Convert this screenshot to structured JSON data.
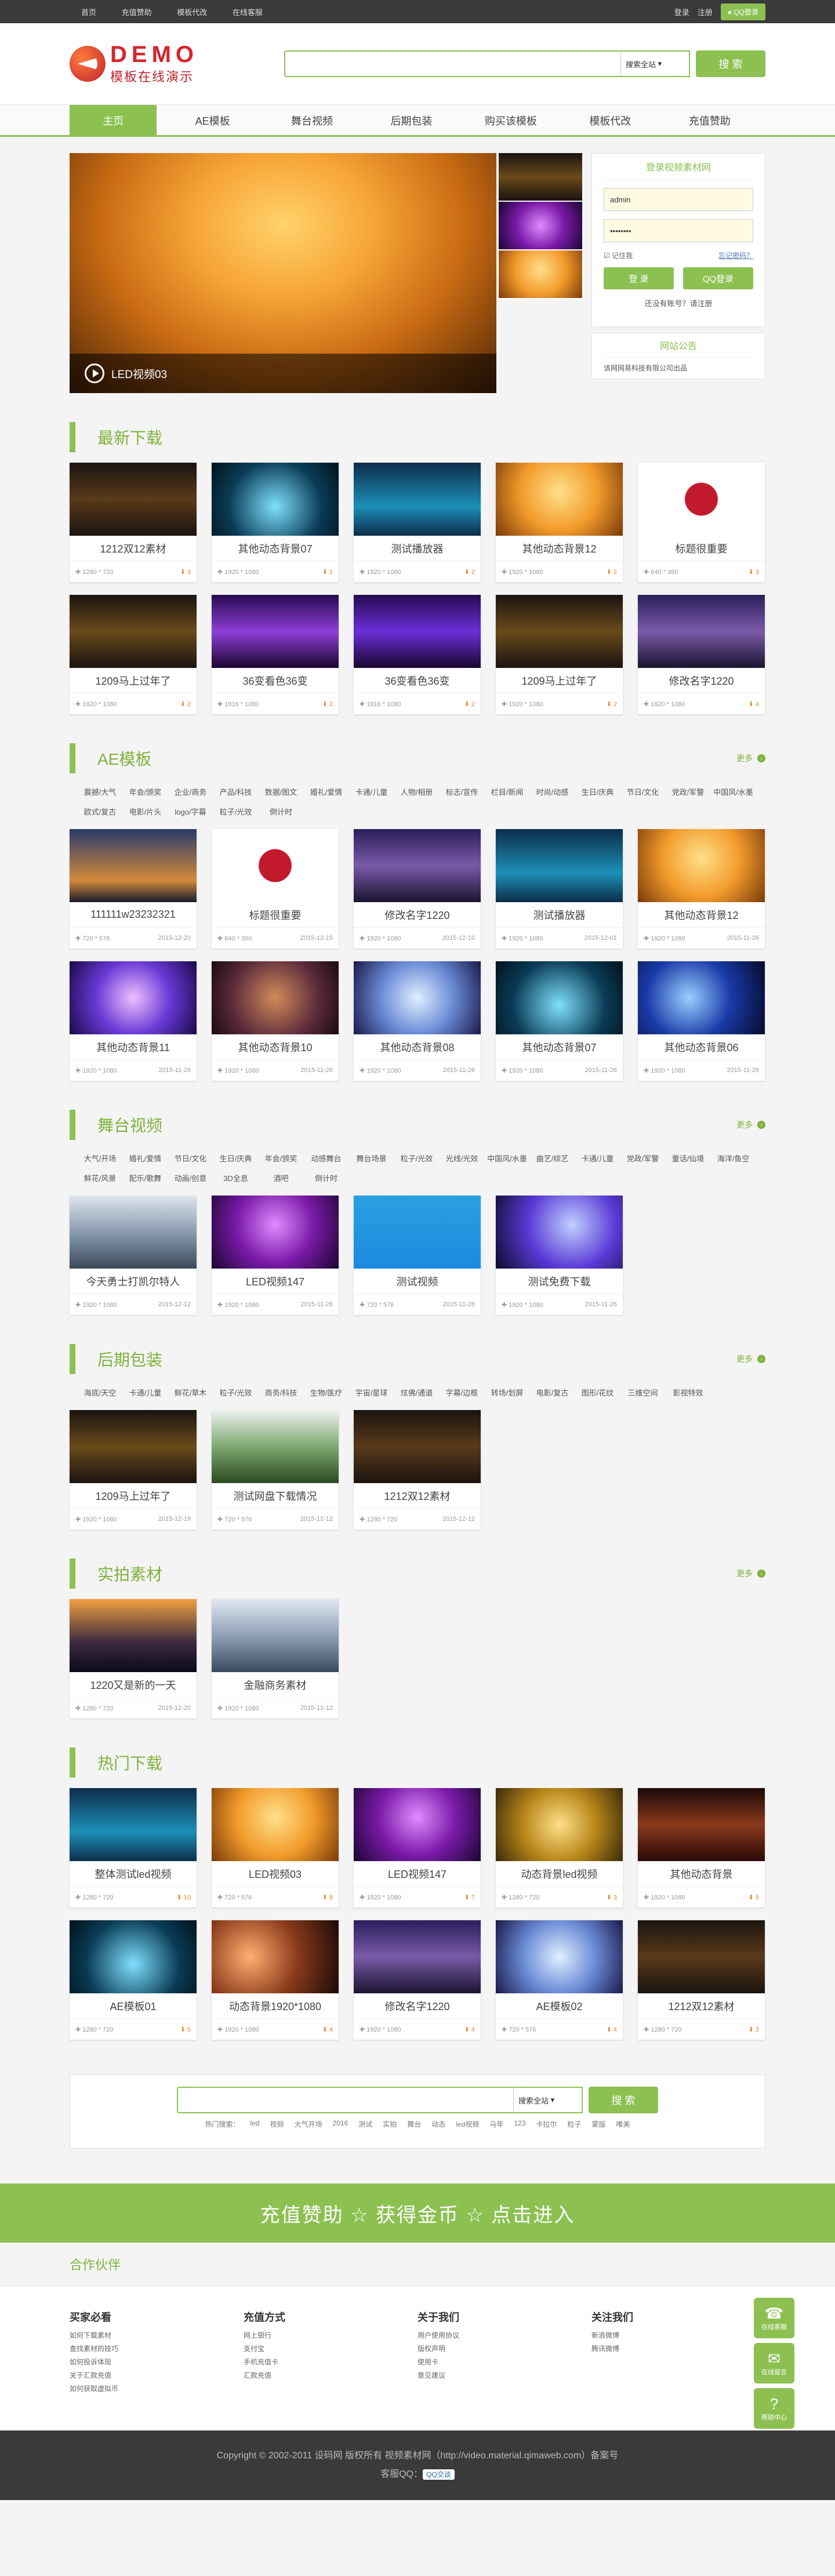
{
  "topbar": {
    "links": [
      "首页",
      "充值赞助",
      "模板代改",
      "在线客服"
    ],
    "login": "登录",
    "register": "注册",
    "qq": "QQ登录"
  },
  "header": {
    "logo_title": "DEMO",
    "logo_sub": "模板在线演示",
    "search_scope": "搜索全站",
    "search_btn": "搜 索"
  },
  "nav": [
    "主页",
    "AE模板",
    "舞台视频",
    "后期包装",
    "购买该模板",
    "模板代改",
    "充值赞助"
  ],
  "banner": {
    "caption": "LED视频03"
  },
  "login": {
    "title": "登录视频素材网",
    "username": "admin",
    "password": "••••••••",
    "remember": "记住我",
    "forgot": "忘记密码？",
    "login_btn": "登 录",
    "qq_btn": "QQ登录",
    "noacc": "还没有账号？请注册"
  },
  "notice": {
    "title": "网站公告",
    "text": "该网网易科技有限公司出品"
  },
  "sections": {
    "latest": {
      "title": "最新下载",
      "items": [
        {
          "name": "1212双12素材",
          "meta": "1280 * 720",
          "count": "3",
          "bg": "linear-gradient(#1a1410,#5a3a1a 50%,#1a1410)"
        },
        {
          "name": "其他动态背景07",
          "meta": "1920 * 1080",
          "count": "1",
          "bg": "radial-gradient(circle at 50% 60%,#7fe0ff,#0a3c55 60%,#02121c)"
        },
        {
          "name": "测试播放器",
          "meta": "1920 * 1080",
          "count": "2",
          "bg": "linear-gradient(#0c2d4a,#1d8fb8 60%,#0c2d4a)"
        },
        {
          "name": "其他动态背景12",
          "meta": "1920 * 1080",
          "count": "2",
          "bg": "radial-gradient(circle at 50% 40%,#ffe08a,#f29b2b 50%,#7a3a08)"
        },
        {
          "name": "标题很重要",
          "meta": "640 * 360",
          "count": "3",
          "bg": "radial-gradient(circle,#c21a2c 0 22%,#fff 23%)"
        },
        {
          "name": "1209马上过年了",
          "meta": "1920 * 1080",
          "count": "2",
          "bg": "linear-gradient(#1a1410,#6a4a1a 50%,#1a1410)"
        },
        {
          "name": "36变看色36变",
          "meta": "1916 * 1080",
          "count": "2",
          "bg": "linear-gradient(#260a52,#8f3ed6 50%,#1a0630)"
        },
        {
          "name": "36变看色36变",
          "meta": "1916 * 1080",
          "count": "2",
          "bg": "linear-gradient(#260a52,#6b2fd6 50%,#1a0630)"
        },
        {
          "name": "1209马上过年了",
          "meta": "1920 * 1080",
          "count": "2",
          "bg": "linear-gradient(#1a1410,#6a4a1a 50%,#1a1410)"
        },
        {
          "name": "修改名字1220",
          "meta": "1920 * 1080",
          "count": "4",
          "bg": "linear-gradient(#2a1e5a,#7a5aa8 50%,#1a1430)"
        }
      ]
    },
    "ae": {
      "title": "AE模板",
      "more": "更多",
      "tags": [
        "震撼/大气",
        "年会/颁奖",
        "企业/商务",
        "产品/科技",
        "数据/图文",
        "婚礼/爱情",
        "卡通/儿童",
        "人物/相册",
        "标志/宣传",
        "栏目/新闻",
        "时尚/动感",
        "生日/庆典",
        "节日/文化",
        "党政/军警",
        "中国风/水墨",
        "欧式/复古",
        "电影/片头",
        "logo/字幕",
        "粒子/光效",
        "倒计时"
      ],
      "items": [
        {
          "name": "111111w23232321",
          "meta": "720 * 576",
          "date": "2015-12-20",
          "bg": "linear-gradient(#2a3a6a,#d28a3a 70%,#1a1a2a)"
        },
        {
          "name": "标题很重要",
          "meta": "640 * 360",
          "date": "2015-12-15",
          "bg": "radial-gradient(circle,#c21a2c 0 22%,#fff 23%)"
        },
        {
          "name": "修改名字1220",
          "meta": "1920 * 1080",
          "date": "2015-12-10",
          "bg": "linear-gradient(#2a1e5a,#7a5aa8 50%,#1a1430)"
        },
        {
          "name": "测试播放器",
          "meta": "1920 * 1080",
          "date": "2015-12-01",
          "bg": "linear-gradient(#0c2d4a,#1d8fb8 60%,#0c2d4a)"
        },
        {
          "name": "其他动态背景12",
          "meta": "1920 * 1080",
          "date": "2015-11-26",
          "bg": "radial-gradient(circle at 50% 40%,#ffe08a,#f29b2b 50%,#7a3a08)"
        },
        {
          "name": "其他动态背景11",
          "meta": "1920 * 1080",
          "date": "2015-11-26",
          "bg": "radial-gradient(circle at 50% 50%,#f0c0ff,#6a3ad6 50%,#1a0a4a)"
        },
        {
          "name": "其他动态背景10",
          "meta": "1920 * 1080",
          "date": "2015-11-26",
          "bg": "radial-gradient(circle at 50% 50%,#d08a5a,#5a2a3a 60%,#1a0a10)"
        },
        {
          "name": "其他动态背景08",
          "meta": "1920 * 1080",
          "date": "2015-11-26",
          "bg": "radial-gradient(circle at 50% 50%,#e0f0ff,#6a8ad6 50%,#1a1a4a)"
        },
        {
          "name": "其他动态背景07",
          "meta": "1920 * 1080",
          "date": "2015-11-26",
          "bg": "radial-gradient(circle at 50% 60%,#7fe0ff,#0a3c55 60%,#02121c)"
        },
        {
          "name": "其他动态背景06",
          "meta": "1920 * 1080",
          "date": "2015-11-26",
          "bg": "radial-gradient(circle at 40% 50%,#9ad0ff,#1a3aa8 50%,#050a2a)"
        }
      ]
    },
    "stage": {
      "title": "舞台视频",
      "more": "更多",
      "tags": [
        "大气/开场",
        "婚礼/爱情",
        "节日/文化",
        "生日/庆典",
        "年会/颁奖",
        "动感舞台",
        "舞台场景",
        "粒子/光效",
        "光线/光效",
        "中国风/水墨",
        "曲艺/综艺",
        "卡通/儿童",
        "党政/军警",
        "童话/仙境",
        "海洋/鱼空",
        "鲜花/风景",
        "配乐/歌舞",
        "动画/创意",
        "3D全息",
        "酒吧",
        "倒计时"
      ],
      "items": [
        {
          "name": "今天勇士打凯尔特人",
          "meta": "1920 * 1080",
          "date": "2015-12-12",
          "bg": "linear-gradient(#e0e6ee,#8a9ab0 50%,#3a4a5a)"
        },
        {
          "name": "LED视频147",
          "meta": "1920 * 1080",
          "date": "2015-11-26",
          "bg": "radial-gradient(circle at 50% 40%,#e08aff,#7a1aa8 50%,#1a0630)"
        },
        {
          "name": "测试视频",
          "meta": "720 * 576",
          "date": "2015-11-26",
          "bg": "linear-gradient(#2aa0e0,#1a8ae0)"
        },
        {
          "name": "测试免费下载",
          "meta": "1920 * 1080",
          "date": "2015-11-26",
          "bg": "radial-gradient(circle at 60% 40%,#c0d0ff,#5a3ad6 50%,#0a0a2a)"
        }
      ]
    },
    "post": {
      "title": "后期包装",
      "more": "更多",
      "tags": [
        "海底/天空",
        "卡通/儿童",
        "鲜花/草木",
        "粒子/光效",
        "商务/科技",
        "生物/医疗",
        "宇宙/星球",
        "炫佛/通道",
        "字幕/边框",
        "转场/划屏",
        "电影/复古",
        "图形/花纹",
        "三维空间",
        "影视特效"
      ],
      "items": [
        {
          "name": "1209马上过年了",
          "meta": "1920 * 1080",
          "date": "2015-12-19",
          "bg": "linear-gradient(#1a1410,#6a4a1a 50%,#1a1410)"
        },
        {
          "name": "测试网盘下载情况",
          "meta": "720 * 576",
          "date": "2015-12-12",
          "bg": "linear-gradient(#eef2f0,#7ea870 50%,#2a4a20)"
        },
        {
          "name": "1212双12素材",
          "meta": "1280 * 720",
          "date": "2015-12-12",
          "bg": "linear-gradient(#1a1410,#5a3a1a 50%,#1a1410)"
        }
      ]
    },
    "shot": {
      "title": "实拍素材",
      "more": "更多",
      "items": [
        {
          "name": "1220又是新的一天",
          "meta": "1280 * 720",
          "date": "2015-12-20",
          "bg": "linear-gradient(#f0a040,#3a2a40 60%,#0a0a18)"
        },
        {
          "name": "金融商务素材",
          "meta": "1920 * 1080",
          "date": "2015-12-12",
          "bg": "linear-gradient(#e0e8f0,#90a0b8 50%,#3a4a60)"
        }
      ]
    },
    "hot": {
      "title": "热门下载",
      "items": [
        {
          "name": "整体测试led视频",
          "meta": "1280 * 720",
          "count": "10",
          "bg": "linear-gradient(#0c2d4a,#1d8fb8 60%,#0c2d4a)"
        },
        {
          "name": "LED视频03",
          "meta": "720 * 576",
          "count": "8",
          "bg": "radial-gradient(circle at 50% 40%,#ffe08a,#f29b2b 50%,#7a3a08)"
        },
        {
          "name": "LED视频147",
          "meta": "1920 * 1080",
          "count": "7",
          "bg": "radial-gradient(circle at 50% 40%,#e08aff,#7a1aa8 50%,#1a0630)"
        },
        {
          "name": "动态背景led视频",
          "meta": "1280 * 720",
          "count": "3",
          "bg": "radial-gradient(circle at 50% 50%,#ffe08a,#b8861a 50%,#3a2a08)"
        },
        {
          "name": "其他动态背景",
          "meta": "1920 * 1080",
          "count": "5",
          "bg": "linear-gradient(#1a0808,#8a3a1a 50%,#2a0808)"
        },
        {
          "name": "AE模板01",
          "meta": "1280 * 720",
          "count": "5",
          "bg": "radial-gradient(circle at 50% 60%,#7fe0ff,#0a3c55 60%,#02121c)"
        },
        {
          "name": "动态背景1920*1080",
          "meta": "1920 * 1080",
          "count": "4",
          "bg": "radial-gradient(circle at 30% 50%,#ffb070,#8a3a1a 50%,#1a0a08)"
        },
        {
          "name": "修改名字1220",
          "meta": "1920 * 1080",
          "count": "4",
          "bg": "linear-gradient(#2a1e5a,#7a5aa8 50%,#1a1430)"
        },
        {
          "name": "AE模板02",
          "meta": "720 * 576",
          "count": "4",
          "bg": "radial-gradient(circle at 50% 50%,#e0f0ff,#6a8ad6 50%,#1a1a4a)"
        },
        {
          "name": "1212双12素材",
          "meta": "1280 * 720",
          "count": "3",
          "bg": "linear-gradient(#1a1410,#5a3a1a 50%,#1a1410)"
        }
      ]
    }
  },
  "bottom_search": {
    "scope": "搜索全站",
    "btn": "搜 索",
    "hot_label": "热门搜索：",
    "hot": [
      "led",
      "视频",
      "大气开场",
      "2016",
      "测试",
      "实拍",
      "舞台",
      "动态",
      "led视频",
      "马年",
      "123",
      "卡拉尔",
      "粒子",
      "蒙版",
      "唯美"
    ]
  },
  "recharge": "充值赞助 ☆ 获得金币 ☆ 点击进入",
  "partners": "合作伙伴",
  "footer": {
    "cols": [
      {
        "title": "买家必看",
        "links": [
          "如何下载素材",
          "查找素材的技巧",
          "如何投诉体现",
          "关于汇款充值",
          "如何获取虚拟币"
        ]
      },
      {
        "title": "充值方式",
        "links": [
          "网上银行",
          "支付宝",
          "手机充值卡",
          "汇款充值"
        ]
      },
      {
        "title": "关于我们",
        "links": [
          "用户使用协议",
          "版权声明",
          "使用卡",
          "意见建议"
        ]
      },
      {
        "title": "关注我们",
        "links": [
          "新浪微博",
          "腾讯微博"
        ]
      }
    ],
    "copyright": "Copyright © 2002-2011 设码网 版权所有 视频素材网（http://video.material.qimaweb.com）备案号",
    "qq_line": "客服QQ：",
    "qq_badge": "QQ交谈"
  },
  "side": {
    "b1": "在线客服",
    "b2": "在线留言",
    "b3": "帮助中心"
  }
}
